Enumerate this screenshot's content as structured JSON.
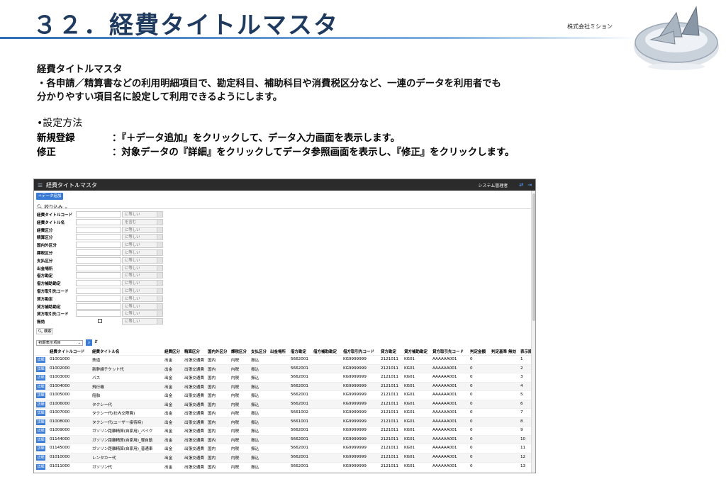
{
  "slide": {
    "title": "３２．経費タイトルマスタ",
    "company": "株式会社ミション"
  },
  "description": {
    "heading": "経費タイトルマスタ",
    "line1": "・各申請／精算書などの利用明細項目で、勘定科目、補助科目や消費税区分など、一連のデータを利用者でも",
    "line2": "分かりやすい項目名に設定して利用できるようにします。",
    "method_heading": "•設定方法",
    "new_label": "新規登録",
    "new_text": "：『＋データ追加』をクリックして、データ入力画面を表示します。",
    "edit_label": "修正",
    "edit_text": "：対象データの『詳細』をクリックしてデータ参照画面を表示し、『修正』をクリックします。"
  },
  "app": {
    "title": "経費タイトルマスタ",
    "user": "システム管理者",
    "add_button": "＋データ追加",
    "filter_toggle": "絞り込み",
    "search_button": "検索",
    "display_select": "初期表示項目",
    "detail_label": "詳細",
    "filters": [
      {
        "label": "経費タイトルコード",
        "op": "に等しい"
      },
      {
        "label": "経費タイトル名",
        "op": "を含む"
      },
      {
        "label": "経費区分",
        "op": "に等しい"
      },
      {
        "label": "精算区分",
        "op": "に等しい"
      },
      {
        "label": "国内外区分",
        "op": "に等しい"
      },
      {
        "label": "課税区分",
        "op": "に等しい"
      },
      {
        "label": "支払区分",
        "op": "に等しい"
      },
      {
        "label": "出金場所",
        "op": "に等しい"
      },
      {
        "label": "借方勘定",
        "op": "に等しい"
      },
      {
        "label": "借方補助勘定",
        "op": "に等しい"
      },
      {
        "label": "借方取引先コード",
        "op": "に等しい"
      },
      {
        "label": "貸方勘定",
        "op": "に等しい"
      },
      {
        "label": "貸方補助勘定",
        "op": "に等しい"
      },
      {
        "label": "貸方取引先コード",
        "op": "に等しい"
      },
      {
        "label": "無効",
        "op": "に等しい"
      }
    ],
    "columns": [
      "経費タイトルコード",
      "経費タイトル名",
      "経費区分",
      "精算区分",
      "国内外区分",
      "課税区分",
      "支払区分",
      "出金場所",
      "借方勘定",
      "借方補助勘定",
      "借方取引先コード",
      "貸方勘定",
      "貸方補助勘定",
      "貸方取引先コード",
      "判定金額",
      "判定基準",
      "無効",
      "表示順"
    ],
    "rows": [
      [
        "01001000",
        "鉄道",
        "出金",
        "出張交通費",
        "国内",
        "内税",
        "振込",
        "",
        "5662001",
        "",
        "KG9999999",
        "2121011",
        "KG01",
        "AAAAAA001",
        "0",
        "",
        "",
        "1"
      ],
      [
        "01002000",
        "新幹線チケット代",
        "出金",
        "出張交通費",
        "国内",
        "内税",
        "振込",
        "",
        "5662001",
        "",
        "KG9999999",
        "2121011",
        "KG01",
        "AAAAAA001",
        "0",
        "",
        "",
        "2"
      ],
      [
        "01003000",
        "バス",
        "出金",
        "出張交通費",
        "国内",
        "内税",
        "振込",
        "",
        "5662001",
        "",
        "KG9999999",
        "2121011",
        "KG01",
        "AAAAAA001",
        "0",
        "",
        "",
        "3"
      ],
      [
        "01004000",
        "飛行機",
        "出金",
        "出張交通費",
        "国内",
        "内税",
        "振込",
        "",
        "5662001",
        "",
        "KG9999999",
        "2121011",
        "KG01",
        "AAAAAA001",
        "0",
        "",
        "",
        "4"
      ],
      [
        "01005000",
        "船舶",
        "出金",
        "出張交通費",
        "国内",
        "内税",
        "振込",
        "",
        "5662001",
        "",
        "KG9999999",
        "2121011",
        "KG01",
        "AAAAAA001",
        "0",
        "",
        "",
        "5"
      ],
      [
        "01006000",
        "タクシー代",
        "出金",
        "出張交通費",
        "国内",
        "内税",
        "振込",
        "",
        "5662001",
        "",
        "KG9999999",
        "2121011",
        "KG01",
        "AAAAAA001",
        "0",
        "",
        "",
        "6"
      ],
      [
        "01007000",
        "タクシー代(社内交際費)",
        "出金",
        "出張交通費",
        "国内",
        "内税",
        "振込",
        "",
        "5661002",
        "",
        "KG9999999",
        "2121011",
        "KG01",
        "AAAAAA001",
        "0",
        "",
        "",
        "7"
      ],
      [
        "01008000",
        "タクシー代(ユーザー接待時)",
        "出金",
        "出張交通費",
        "国内",
        "内税",
        "振込",
        "",
        "5661001",
        "",
        "KG9999999",
        "2121011",
        "KG01",
        "AAAAAA001",
        "0",
        "",
        "",
        "8"
      ],
      [
        "01009000",
        "ガソリン距離精算(自家用)_バイク",
        "出金",
        "出張交通費",
        "国内",
        "内税",
        "振込",
        "",
        "5662001",
        "",
        "KG9999999",
        "2121011",
        "KG01",
        "AAAAAA001",
        "0",
        "",
        "",
        "9"
      ],
      [
        "01144000",
        "ガソリン距離精算(自家用)_軽自動",
        "出金",
        "出張交通費",
        "国内",
        "内税",
        "振込",
        "",
        "5662001",
        "",
        "KG9999999",
        "2121011",
        "KG01",
        "AAAAAA001",
        "0",
        "",
        "",
        "10"
      ],
      [
        "01145000",
        "ガソリン距離精算(自家用)_普通車",
        "出金",
        "出張交通費",
        "国内",
        "内税",
        "振込",
        "",
        "5662001",
        "",
        "KG9999999",
        "2121011",
        "KG01",
        "AAAAAA001",
        "0",
        "",
        "",
        "11"
      ],
      [
        "01010000",
        "レンタカー代",
        "出金",
        "出張交通費",
        "国内",
        "内税",
        "振込",
        "",
        "5662001",
        "",
        "KG9999999",
        "2121011",
        "KG01",
        "AAAAAA001",
        "0",
        "",
        "",
        "12"
      ],
      [
        "01011000",
        "ガソリン代",
        "出金",
        "出張交通費",
        "国内",
        "内税",
        "振込",
        "",
        "5662001",
        "",
        "KG9999999",
        "2121011",
        "KG01",
        "AAAAAA001",
        "0",
        "",
        "",
        "13"
      ]
    ]
  }
}
